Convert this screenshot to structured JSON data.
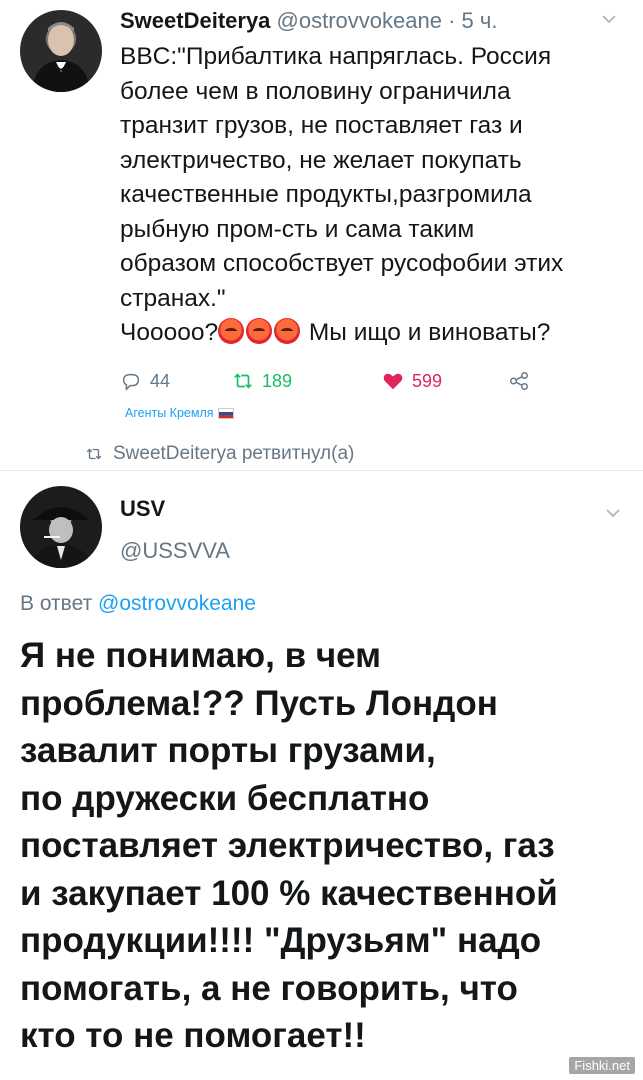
{
  "tweet1": {
    "author_name": "SweetDeiterya",
    "author_handle": "@ostrovvokeane",
    "time": " · 5 ч.",
    "lines": [
      "BBC:\"Прибалтика напряглась. Россия",
      "более чем в половину ограничила",
      "транзит грузов, не поставляет газ и",
      "электричество, не желает покупать",
      "качественные продукты,разгромила",
      "рыбную пром-сть и сама таким",
      "образом способствует русофобии этих",
      "странах.\""
    ],
    "last_line_start": "Чооооо?",
    "last_line_end": " Мы ищо и виноваты?",
    "emoji": [
      "angry-face-icon",
      "angry-face-icon",
      "angry-face-icon"
    ],
    "reply_count": "44",
    "retweet_count": "189",
    "like_count": "599",
    "agents_label": "Агенты Кремля"
  },
  "retweet_notice": "SweetDeiterya ретвитнул(а)",
  "tweet2": {
    "author_name": "USV",
    "author_handle": "@USSVVA",
    "reply_prefix": "В ответ ",
    "reply_to_handle": "@ostrovvokeane",
    "lines": [
      "Я не понимаю,  в чем",
      "проблема!?? Пусть Лондон",
      "завалит порты грузами,",
      "по дружески бесплатно",
      "поставляет электричество, газ",
      "и закупает 100 % качественной",
      "продукции!!!!  \"Друзьям\" надо",
      "помогать,  а не говорить,  что",
      "кто то не помогает!!"
    ]
  },
  "watermark": "Fishki.net",
  "colors": {
    "accent": "#1da1f2",
    "retweet": "#17bf63",
    "like": "#e0245e",
    "muted": "#657786"
  }
}
